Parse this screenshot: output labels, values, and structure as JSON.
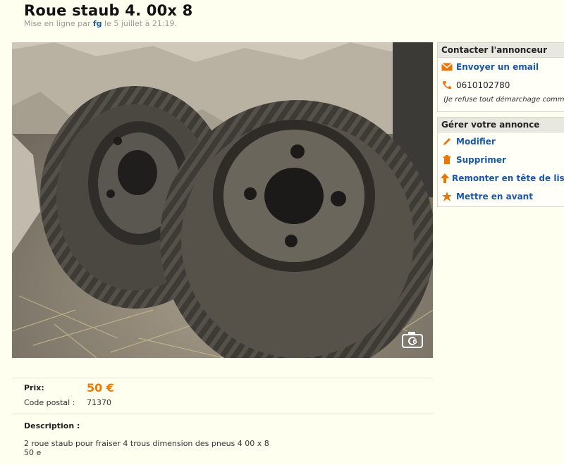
{
  "ad": {
    "title": "Roue staub 4. 00x 8",
    "posted_prefix": "Mise en ligne par",
    "author": "fg",
    "posted_suffix": "le 5 juillet à 21:19."
  },
  "photo": {
    "alt": "Deux roues avec pneus agricoles",
    "photo_count": "6",
    "camera_icon": "camera-icon"
  },
  "contact": {
    "header": "Contacter l'annonceur",
    "email_label": "Envoyer un email",
    "phone": "0610102780",
    "note": "(Je refuse tout démarchage comm"
  },
  "manage": {
    "header": "Gérer votre annonce",
    "items": [
      {
        "label": "Modifier",
        "icon": "pencil-icon"
      },
      {
        "label": "Supprimer",
        "icon": "trash-icon"
      },
      {
        "label": "Remonter en tête de liste",
        "icon": "arrow-up-icon"
      },
      {
        "label": "Mettre en avant",
        "icon": "star-icon"
      }
    ]
  },
  "details": {
    "price_label": "Prix:",
    "price_value": "50 €",
    "postal_label": "Code postal :",
    "postal_value": "71370",
    "description_label": "Description :",
    "description_line1": "2 roue staub pour fraiser 4 trous dimension des pneus 4 00 x 8",
    "description_line2": "50 e"
  },
  "colors": {
    "page_bg": "#ffffef",
    "link": "#1a57a8",
    "price": "#f07800",
    "icon_orange": "#e8760a"
  }
}
